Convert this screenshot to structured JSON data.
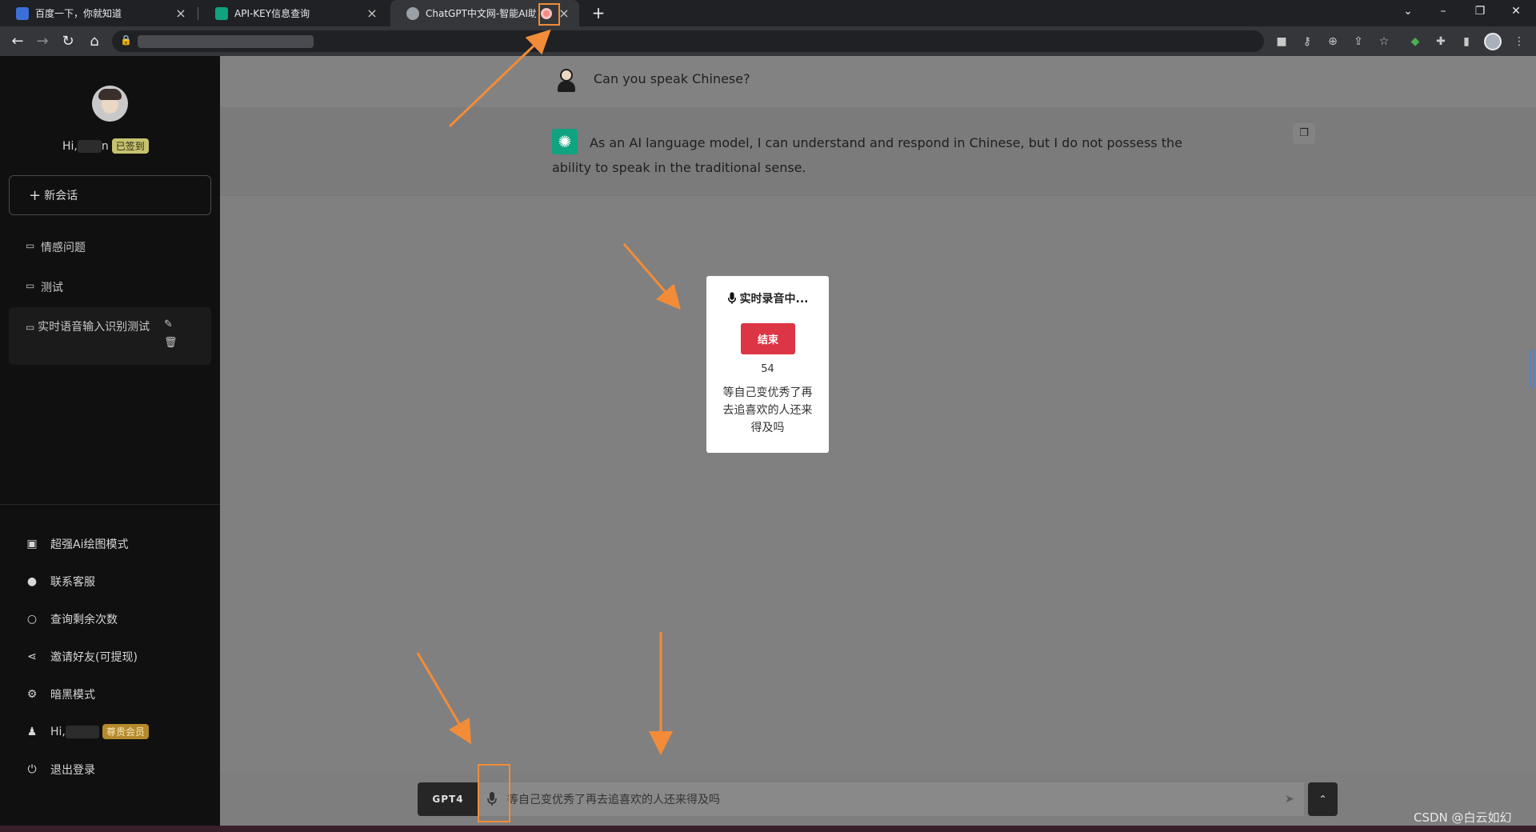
{
  "browser": {
    "tabs": [
      {
        "title": "百度一下，你就知道"
      },
      {
        "title": "API-KEY信息查询"
      },
      {
        "title": "ChatGPT中文网-智能AI助手"
      }
    ],
    "new_tab": "+",
    "window_controls": {
      "chevron": "⌄",
      "minimize": "–",
      "restore": "❐",
      "close": "✕"
    }
  },
  "sidebar": {
    "greeting": "Hi,",
    "greeting_tail": "n",
    "signed_badge": "已签到",
    "new_chat": "新会话",
    "conversations": [
      {
        "label": "情感问题"
      },
      {
        "label": "测试"
      },
      {
        "label": "实时语音输入识别测试",
        "active": true
      }
    ],
    "menu": [
      {
        "label": "超强Ai绘图模式",
        "icon": "image-icon"
      },
      {
        "label": "联系客服",
        "icon": "wechat-icon"
      },
      {
        "label": "查询剩余次数",
        "icon": "search-icon"
      },
      {
        "label": "邀请好友(可提现)",
        "icon": "share-icon"
      },
      {
        "label": "暗黑模式",
        "icon": "gear-icon"
      },
      {
        "label": "Hi,",
        "icon": "user-icon",
        "badge": "尊贵会员"
      },
      {
        "label": "退出登录",
        "icon": "power-icon"
      }
    ]
  },
  "chat": {
    "user_message": "Can you speak Chinese?",
    "ai_message": "As an AI language model, I can understand and respond in Chinese, but I do not possess the ability to speak in the traditional sense."
  },
  "modal": {
    "title": "实时录音中...",
    "end_button": "结束",
    "count": "54",
    "recognized_text": "等自己变优秀了再去追喜欢的人还来得及吗"
  },
  "input": {
    "model_button": "GPT4",
    "value": "等自己变优秀了再去追喜欢的人还来得及吗"
  },
  "watermark": "CSDN @白云如幻",
  "colors": {
    "accent_orange": "#f28c38",
    "end_red": "#dc3545",
    "gpt_green": "#10a37f",
    "badge_green": "#c7c26e",
    "badge_gold": "#b48a2c"
  }
}
